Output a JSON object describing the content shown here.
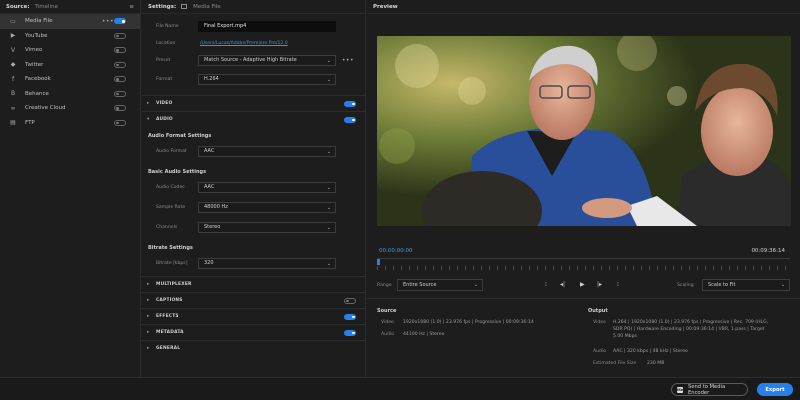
{
  "source": {
    "header": {
      "title": "Source:",
      "tab": "Timeline",
      "menu": "≡"
    },
    "items": [
      {
        "label": "Media File",
        "icon": "media-file-icon",
        "glyph": "▭",
        "enabled": true,
        "active": true
      },
      {
        "label": "YouTube",
        "icon": "youtube-icon",
        "glyph": "▶",
        "enabled": false
      },
      {
        "label": "Vimeo",
        "icon": "vimeo-icon",
        "glyph": "V",
        "enabled": false
      },
      {
        "label": "Twitter",
        "icon": "twitter-icon",
        "glyph": "◆",
        "enabled": false
      },
      {
        "label": "Facebook",
        "icon": "facebook-icon",
        "glyph": "f",
        "enabled": false
      },
      {
        "label": "Behance",
        "icon": "behance-icon",
        "glyph": "B",
        "enabled": false
      },
      {
        "label": "Creative Cloud",
        "icon": "creative-cloud-icon",
        "glyph": "∞",
        "enabled": false
      },
      {
        "label": "FTP",
        "icon": "ftp-icon",
        "glyph": "▤",
        "enabled": false
      }
    ],
    "more": "•••"
  },
  "settings": {
    "header": {
      "title": "Settings:",
      "tab": "Media File"
    },
    "file_name_label": "File Name",
    "file_name": "Final Export.mp4",
    "location_label": "Location",
    "location": "/Users/Lucas/Adobe/Premiere Pro/12.0",
    "preset_label": "Preset",
    "preset": "Match Source - Adaptive High Bitrate",
    "format_label": "Format",
    "format": "H.264",
    "more": "•••",
    "sections": {
      "video": "VIDEO",
      "audio": "AUDIO",
      "multiplexer": "MULTIPLEXER",
      "captions": "CAPTIONS",
      "effects": "EFFECTS",
      "metadata": "METADATA",
      "general": "GENERAL"
    },
    "audio_format_settings": {
      "title": "Audio Format Settings",
      "audio_format_label": "Audio Format",
      "audio_format": "AAC"
    },
    "basic_audio_settings": {
      "title": "Basic Audio Settings",
      "audio_codec_label": "Audio Codec",
      "audio_codec": "AAC",
      "sample_rate_label": "Sample Rate",
      "sample_rate": "48000 Hz",
      "channels_label": "Channels",
      "channels": "Stereo"
    },
    "bitrate_settings": {
      "title": "Bitrate Settings",
      "bitrate_label": "Bitrate [kbps]",
      "bitrate": "320"
    }
  },
  "preview": {
    "header": {
      "title": "Preview"
    },
    "timecode_start": "00:00:00:00",
    "timecode_end": "00:09:36:14",
    "playhead_fraction": 0.0,
    "range_label": "Range",
    "range": "Entire Source",
    "scaling_label": "Scaling",
    "scaling": "Scale to Fit",
    "transport": {
      "mark_in": "⁝",
      "go_in": "⇤",
      "step_back": "◂|",
      "play": "▶",
      "step_fwd": "|▸",
      "go_out": "⇥",
      "mark_out": "⁝"
    },
    "source_info": {
      "title": "Source",
      "video_label": "Video",
      "video": "1920x1080 (1.0)  |  23.976 fps  |  Progressive  |  00:09:36:14",
      "audio_label": "Audio",
      "audio": "44100 Hz  |  Stereo"
    },
    "output_info": {
      "title": "Output",
      "video_label": "Video",
      "video_line1": "H.264  |  1920x1080 (1.0)  |  23.976 fps  |  Progressive  |  Rec. 709 (HLG,",
      "video_line2": "SDR PQ)  |  Hardware Encoding  |  00:09:36:14  |  VBR, 1 pass  |  Target",
      "video_line3": "5.00 Mbps",
      "audio_label": "Audio",
      "audio": "AAC  |  320 kbps  |  48 kHz  |  Stereo",
      "size_label": "Estimated File Size",
      "size": "230 MB"
    }
  },
  "footer": {
    "send_label": "Send to Media Encoder",
    "send_badge": "Me",
    "export_label": "Export"
  },
  "colors": {
    "accent": "#2680eb",
    "panel": "#1d1d1d",
    "link": "#4b8fd6"
  }
}
